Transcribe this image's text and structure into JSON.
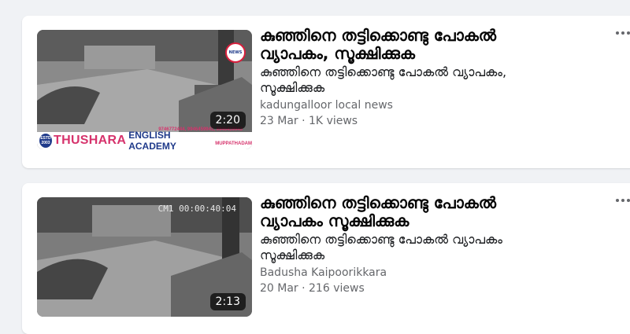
{
  "posts": [
    {
      "title": "കുഞ്ഞിനെ തട്ടിക്കൊണ്ടു പോകൽ വ്യാപകം, സൂക്ഷിക്കുക",
      "description": "കുഞ്ഞിനെ തട്ടിക്കൊണ്ടു പോകൽ വ്യാപകം, സൂക്ഷിക്കുക",
      "source": "kadungalloor local news",
      "meta": "23 Mar · 1K views",
      "duration": "2:20",
      "banner": {
        "estd": "ESTD 2003",
        "brand_main": "THUSHARA",
        "brand_sub": "ENGLISH ACADEMY",
        "place": "MUPPATHADAM",
        "phones": "9746772444, 9946459941, 9946459943"
      },
      "badge_text": "NEWS"
    },
    {
      "title": "കുഞ്ഞിനെ തട്ടിക്കൊണ്ടു പോകൽ വ്യാപകം സൂക്ഷിക്കുക",
      "description": "കുഞ്ഞിനെ തട്ടിക്കൊണ്ടു പോകൽ വ്യാപകം സൂക്ഷിക്കുക",
      "source": "Badusha Kaipoorikkara",
      "meta": "20 Mar · 216 views",
      "duration": "2:13",
      "cam_stamp": "CM1 00:00:40:04"
    }
  ],
  "icons": {
    "more": "more-dots-icon"
  }
}
